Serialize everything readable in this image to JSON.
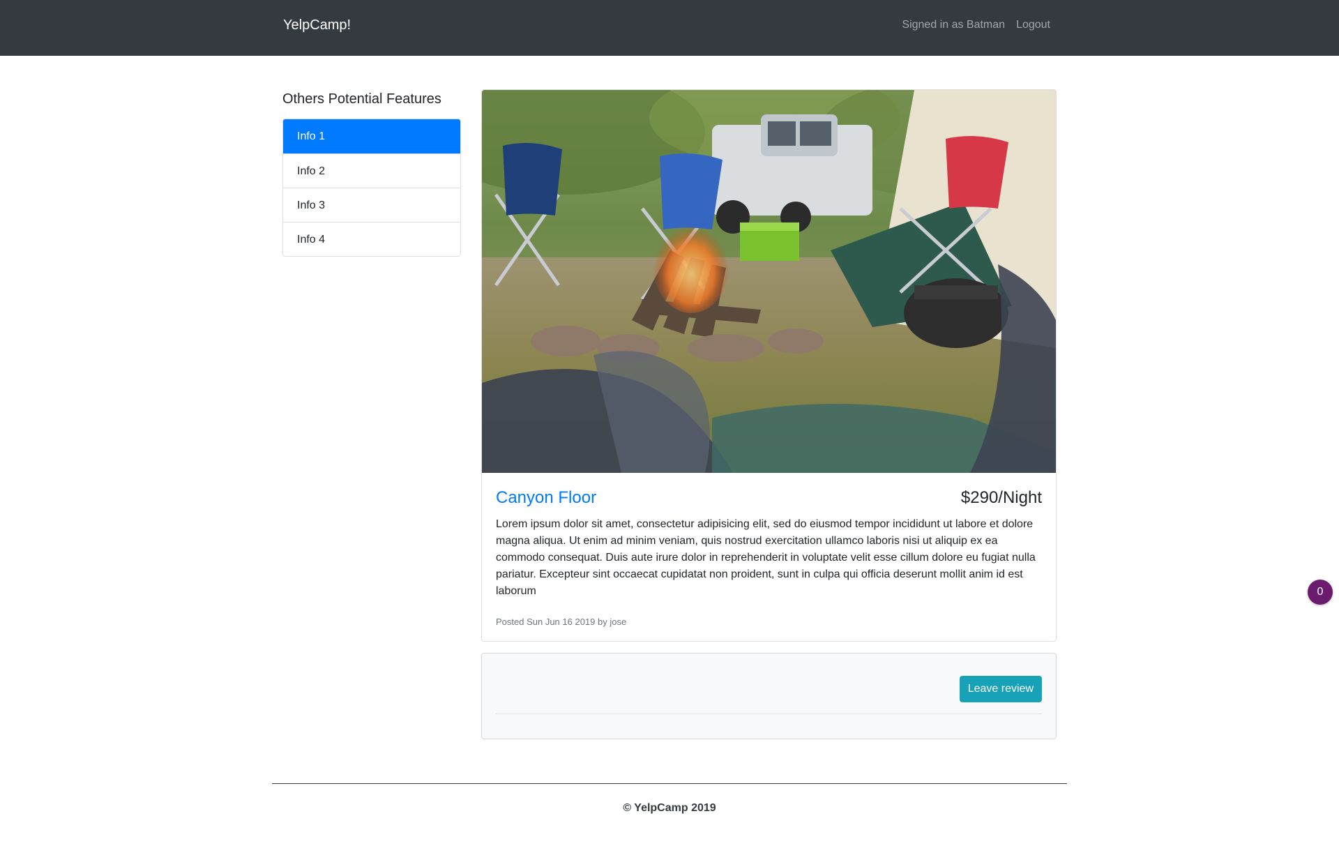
{
  "navbar": {
    "brand": "YelpCamp!",
    "signed_in": "Signed in as Batman",
    "logout": "Logout"
  },
  "sidebar": {
    "title": "Others Potential Features",
    "items": [
      {
        "label": "Info 1"
      },
      {
        "label": "Info 2"
      },
      {
        "label": "Info 3"
      },
      {
        "label": "Info 4"
      }
    ]
  },
  "campground": {
    "name": "Canyon Floor",
    "price": "$290/Night",
    "description": "Lorem ipsum dolor sit amet, consectetur adipisicing elit, sed do eiusmod tempor incididunt ut labore et dolore magna aliqua. Ut enim ad minim veniam, quis nostrud exercitation ullamco laboris nisi ut aliquip ex ea commodo consequat. Duis aute irure dolor in reprehenderit in voluptate velit esse cillum dolore eu fugiat nulla pariatur. Excepteur sint occaecat cupidatat non proident, sunt in culpa qui officia deserunt mollit anim id est laborum",
    "meta": "Posted Sun Jun 16 2019 by jose"
  },
  "reviews": {
    "button": "Leave review"
  },
  "footer": {
    "text": "© YelpCamp 2019"
  },
  "floating_badge": {
    "count": "0"
  }
}
